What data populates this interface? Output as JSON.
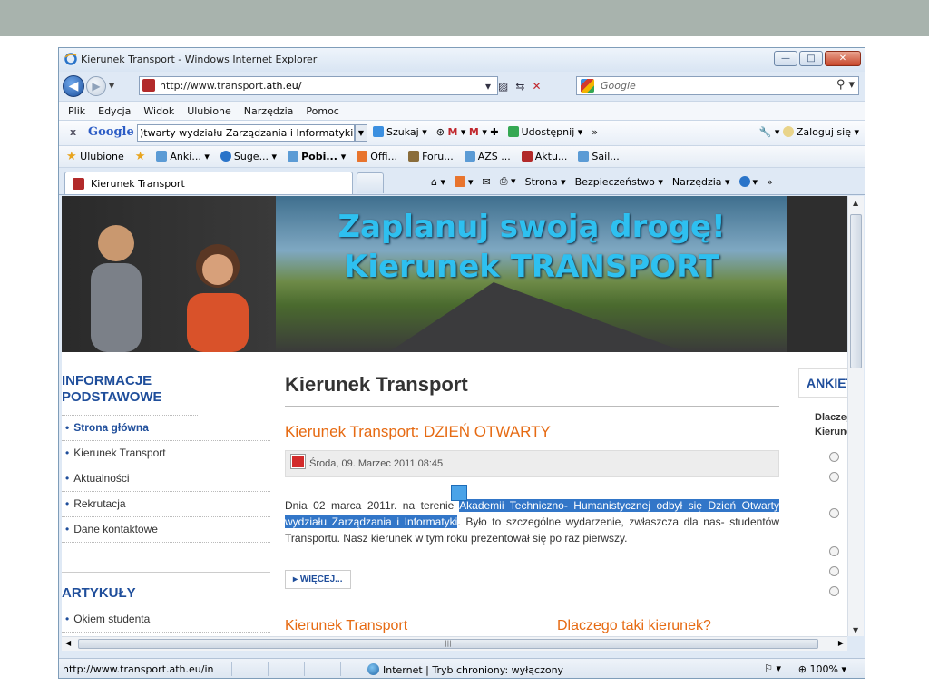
{
  "window": {
    "title": "Kierunek Transport - Windows Internet Explorer"
  },
  "address": {
    "url_prefix": "http://www.transport.",
    "url_domain": "ath.eu/"
  },
  "search": {
    "placeholder": "Google"
  },
  "menu": [
    "Plik",
    "Edycja",
    "Widok",
    "Ulubione",
    "Narzędzia",
    "Pomoc"
  ],
  "google_toolbar": {
    "logo": "Google",
    "query": ")twarty wydziału Zarządzania i Informatyki",
    "search_label": "Szukaj",
    "share_label": "Udostępnij",
    "more": "»",
    "login_label": "Zaloguj się"
  },
  "favorites": {
    "label": "Ulubione",
    "items": [
      "Anki...",
      "Suge...",
      "Pobi...",
      "Offi...",
      "Foru...",
      "AZS ...",
      "Aktu...",
      "Sail..."
    ]
  },
  "tab": {
    "label": "Kierunek Transport"
  },
  "commandbar": {
    "page": "Strona",
    "security": "Bezpieczeństwo",
    "tools": "Narzędzia",
    "more": "»"
  },
  "banner": {
    "line1": "Zaplanuj swoją drogę!",
    "line2": "Kierunek TRANSPORT"
  },
  "sidebar": {
    "heading1": "INFORMACJE PODSTAWOWE",
    "items": [
      "Strona główna",
      "Kierunek Transport",
      "Aktualności",
      "Rekrutacja",
      "Dane kontaktowe"
    ],
    "heading2": "ARTYKUŁY",
    "cut_item": "Okiem studenta"
  },
  "article": {
    "page_title": "Kierunek Transport",
    "headline": "Kierunek Transport: DZIEŃ OTWARTY",
    "date": "Środa, 09. Marzec 2011 08:45",
    "text_start": "Dnia 02 marca 2011r. na terenie ",
    "text_highlight": "Akademii Techniczno- Humanistycznej odbył się Dzień Otwarty wydziału Zarządzania i Informatyki",
    "text_end": ". Było to szczególne wydarzenie, zwłaszcza dla nas- studentów Transportu. Nasz kierunek w tym roku prezentował się po raz pierwszy.",
    "more_label": "WIĘCEJ...",
    "next_left": "Kierunek Transport",
    "next_right": "Dlaczego taki kierunek?"
  },
  "poll": {
    "heading": "ANKIETA",
    "question": "Dlaczego Kierunek"
  },
  "status": {
    "url": "http://www.transport.ath.eu/in",
    "zone": "Internet | Tryb chroniony: wyłączony",
    "zoom": "100%"
  }
}
